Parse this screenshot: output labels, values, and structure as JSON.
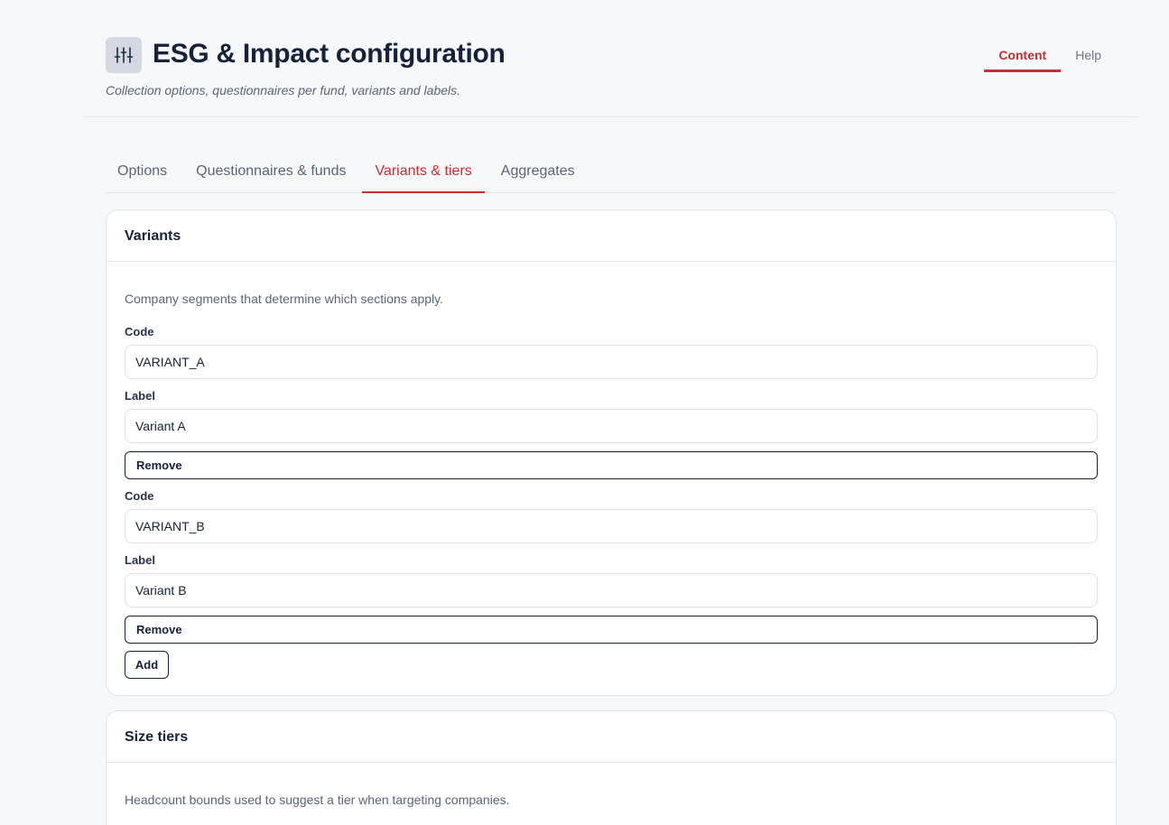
{
  "header": {
    "icon": "sliders-icon",
    "title": "ESG & Impact configuration",
    "subtitle": "Collection options, questionnaires per fund, variants and labels."
  },
  "top_nav": [
    {
      "label": "Content",
      "active": true
    },
    {
      "label": "Help",
      "active": false
    }
  ],
  "tabs": [
    {
      "label": "Options",
      "active": false
    },
    {
      "label": "Questionnaires & funds",
      "active": false
    },
    {
      "label": "Variants & tiers",
      "active": true
    },
    {
      "label": "Aggregates",
      "active": false
    }
  ],
  "variants": {
    "title": "Variants",
    "description": "Company segments that determine which sections apply.",
    "items": [
      {
        "code_label": "Code",
        "code": "VARIANT_A",
        "label_label": "Label",
        "label": "Variant A",
        "remove_label": "Remove"
      },
      {
        "code_label": "Code",
        "code": "VARIANT_B",
        "label_label": "Label",
        "label": "Variant B",
        "remove_label": "Remove"
      }
    ],
    "add_label": "Add"
  },
  "size_tiers": {
    "title": "Size tiers",
    "description": "Headcount bounds used to suggest a tier when targeting companies."
  },
  "colors": {
    "accent": "#c53030",
    "text_primary": "#16213a",
    "background": "#f7f8fa"
  }
}
